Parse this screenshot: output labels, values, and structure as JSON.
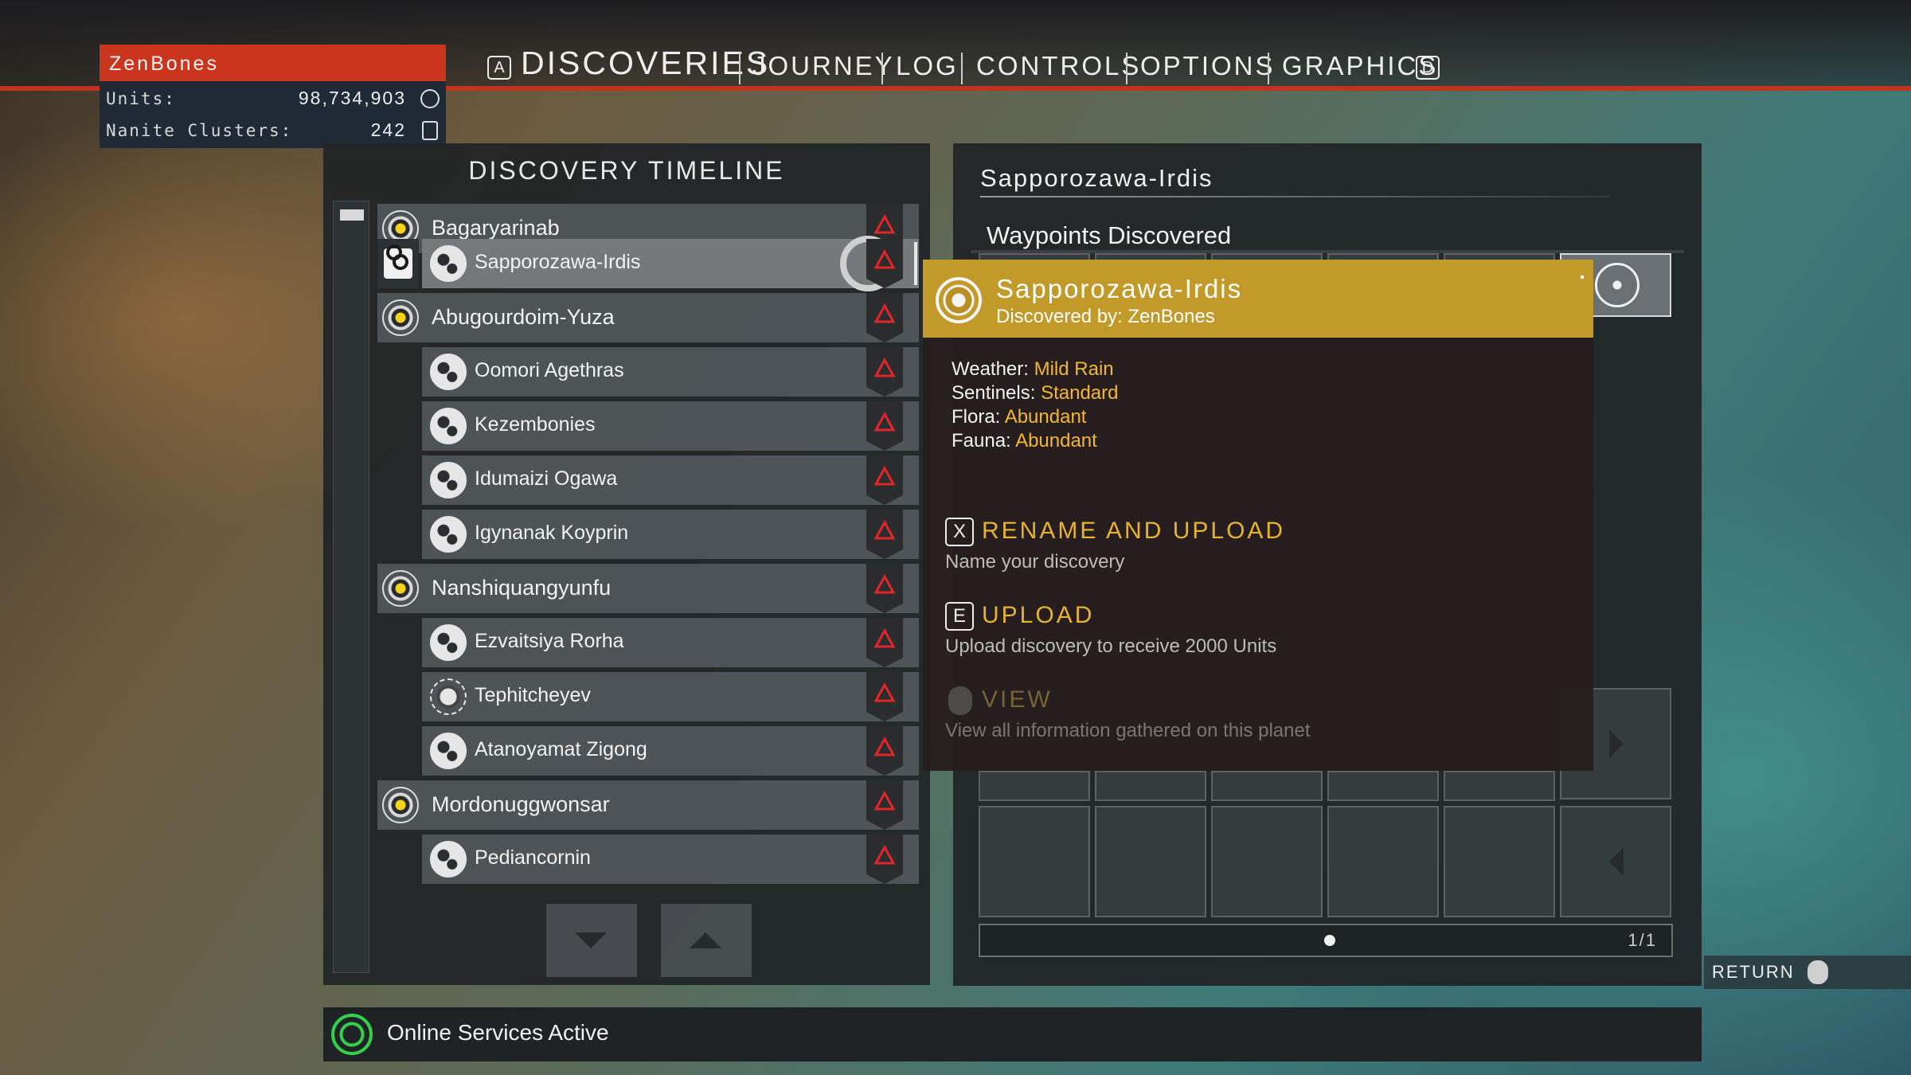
{
  "player": {
    "name": "ZenBones",
    "units_label": "Units:",
    "units_value": "98,734,903",
    "nanites_label": "Nanite Clusters:",
    "nanites_value": "242",
    "units_icon": "units-icon",
    "nanites_icon": "nanite-icon"
  },
  "nav": {
    "left_key": "A",
    "right_key": "D",
    "tabs": [
      {
        "label": "DISCOVERIES",
        "active": true
      },
      {
        "label": "JOURNEY"
      },
      {
        "label": "LOG"
      },
      {
        "label": "CONTROLS"
      },
      {
        "label": "OPTIONS"
      },
      {
        "label": "GRAPHICS"
      }
    ]
  },
  "timeline": {
    "title": "DISCOVERY TIMELINE",
    "items": [
      {
        "name": "Bagaryarinab",
        "kind": "system"
      },
      {
        "name": "Sapporozawa-Irdis",
        "kind": "planet",
        "selected": true,
        "waypoint": true
      },
      {
        "name": "Abugourdoim-Yuza",
        "kind": "system"
      },
      {
        "name": "Oomori Agethras",
        "kind": "planet"
      },
      {
        "name": "Kezembonies",
        "kind": "planet"
      },
      {
        "name": "Idumaizi Ogawa",
        "kind": "planet"
      },
      {
        "name": "Igynanak Koyprin",
        "kind": "planet"
      },
      {
        "name": "Nanshiquangyunfu",
        "kind": "system"
      },
      {
        "name": "Ezvaitsiya Rorha",
        "kind": "planet"
      },
      {
        "name": "Tephitcheyev",
        "kind": "moon"
      },
      {
        "name": "Atanoyamat Zigong",
        "kind": "planet"
      },
      {
        "name": "Mordonuggwonsar",
        "kind": "system"
      },
      {
        "name": "Pediancornin",
        "kind": "planet"
      }
    ]
  },
  "detail": {
    "title": "Sapporozawa-Irdis",
    "waypoints_heading": "Waypoints Discovered",
    "page": "1/1"
  },
  "popup": {
    "title": "Sapporozawa-Irdis",
    "subtitle": "Discovered by: ZenBones",
    "stats": [
      {
        "label": "Weather:",
        "value": "Mild Rain"
      },
      {
        "label": "Sentinels:",
        "value": "Standard"
      },
      {
        "label": "Flora:",
        "value": "Abundant"
      },
      {
        "label": "Fauna:",
        "value": "Abundant"
      }
    ],
    "actions": [
      {
        "key": "X",
        "title": "RENAME AND UPLOAD",
        "desc": "Name your discovery"
      },
      {
        "key": "E",
        "title": "UPLOAD",
        "desc": "Upload discovery to receive 2000 Units"
      },
      {
        "key": "",
        "title": "VIEW",
        "desc": "View all information gathered on this planet"
      }
    ],
    "accent": "#c29a2a",
    "value_color": "#f3b733"
  },
  "status": {
    "text": "Online Services Active",
    "color": "#33d04a"
  },
  "return_label": "RETURN"
}
